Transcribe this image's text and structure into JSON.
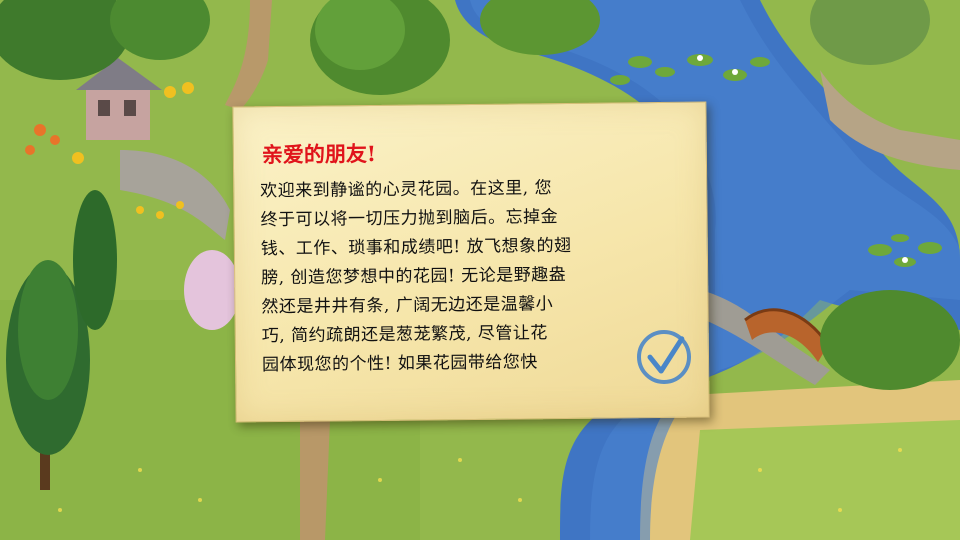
{
  "dialog": {
    "title": "亲爱的朋友!",
    "body_lines": [
      "欢迎来到静谧的心灵花园。在这里, 您",
      "终于可以将一切压力抛到脑后。忘掉金",
      "钱、工作、琐事和成绩吧! 放飞想象的翅",
      "膀, 创造您梦想中的花园! 无论是野趣盎",
      "然还是井井有条, 广阔无边还是温馨小",
      "巧, 简约疏朗还是葱茏繁茂, 尽管让花",
      "园体现您的个性! 如果花园带给您快"
    ],
    "confirm_icon": "checkmark-circle-icon"
  },
  "colors": {
    "title": "#e0141b",
    "paper": "#f6e6ab",
    "grass": "#8fb34a",
    "water": "#3f75c4",
    "check": "#4a86c8"
  }
}
